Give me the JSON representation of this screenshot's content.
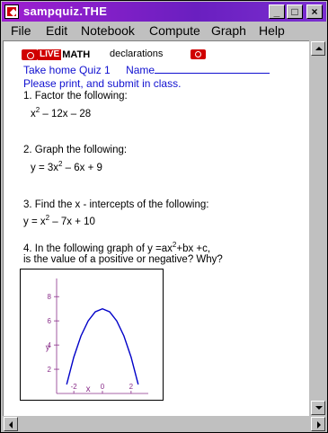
{
  "window": {
    "title": "sampquiz.THE",
    "controls": {
      "minimize": "_",
      "maximize": "□",
      "close": "×"
    }
  },
  "menu": {
    "items": [
      {
        "label": "File",
        "mnemonic": "F"
      },
      {
        "label": "Edit",
        "mnemonic": "E"
      },
      {
        "label": "Notebook",
        "mnemonic": "N"
      },
      {
        "label": "Compute",
        "mnemonic": "C"
      },
      {
        "label": "Graph",
        "mnemonic": "G"
      },
      {
        "label": "Help",
        "mnemonic": "H"
      }
    ]
  },
  "toolbar": {
    "logo_live": "LIVE",
    "logo_math": "MATH",
    "declarations": "declarations"
  },
  "document": {
    "header_title": "Take home Quiz 1",
    "name_label": "Name",
    "instruction": "Please print, and submit in class.",
    "q1": {
      "text": "1.  Factor the following:",
      "expr_a": "x",
      "exp": "2",
      "expr_b": " – 12x – 28"
    },
    "q2": {
      "text": "2.  Graph the following:",
      "expr_a": "y = 3x",
      "exp": "2",
      "expr_b": " – 6x + 9"
    },
    "q3": {
      "text": "3.  Find the x - intercepts of the following:",
      "expr_a": "y = x",
      "exp": "2",
      "expr_b": " – 7x + 10"
    },
    "q4": {
      "line1_a": "4.  In the following graph of y  =ax",
      "exp": "2",
      "line1_b": "+bx +c,",
      "line2": "is the value of a positive or negative? Why?"
    }
  },
  "graph": {
    "ylabel": "y",
    "xlabel": "x",
    "x_ticks": [
      "-2",
      "0",
      "2"
    ],
    "y_ticks": [
      "8",
      "6",
      "4",
      "2"
    ],
    "curve_color": "#0000c8",
    "axis_color": "#8a2f8a"
  },
  "chart_data": {
    "type": "line",
    "series": [
      {
        "x": [
          -2.5,
          -2,
          -1.5,
          -1,
          -0.5,
          0,
          0.5,
          1,
          1.5,
          2,
          2.5
        ],
        "y": [
          0.75,
          3,
          4.75,
          6,
          6.75,
          7,
          6.75,
          6,
          4.75,
          3,
          0.75
        ]
      }
    ],
    "xlabel": "x",
    "ylabel": "y",
    "xlim": [
      -3.2,
      3.2
    ],
    "ylim": [
      0,
      9.5
    ]
  }
}
